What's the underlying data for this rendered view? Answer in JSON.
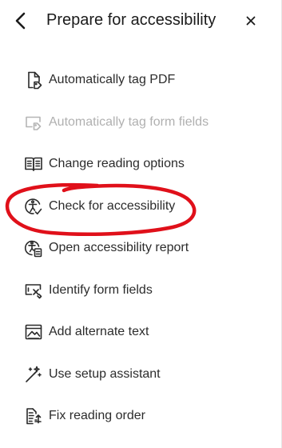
{
  "header": {
    "title": "Prepare for accessibility",
    "back_icon": "chevron-left-icon",
    "close_label": "×"
  },
  "menu": {
    "items": [
      {
        "label": "Automatically tag PDF",
        "icon": "document-tag-icon",
        "disabled": false
      },
      {
        "label": "Automatically tag form fields",
        "icon": "form-tag-icon",
        "disabled": true
      },
      {
        "label": "Change reading options",
        "icon": "book-open-icon",
        "disabled": false
      },
      {
        "label": "Check for accessibility",
        "icon": "accessibility-check-icon",
        "disabled": false
      },
      {
        "label": "Open accessibility report",
        "icon": "accessibility-report-icon",
        "disabled": false
      },
      {
        "label": "Identify form fields",
        "icon": "form-identify-icon",
        "disabled": false
      },
      {
        "label": "Add alternate text",
        "icon": "image-alt-text-icon",
        "disabled": false
      },
      {
        "label": "Use setup assistant",
        "icon": "magic-wand-icon",
        "disabled": false
      },
      {
        "label": "Fix reading order",
        "icon": "reading-order-icon",
        "disabled": false
      }
    ]
  },
  "annotation": {
    "shape": "hand-drawn-ellipse",
    "color": "#e0101a",
    "target_item": "Check for accessibility"
  }
}
